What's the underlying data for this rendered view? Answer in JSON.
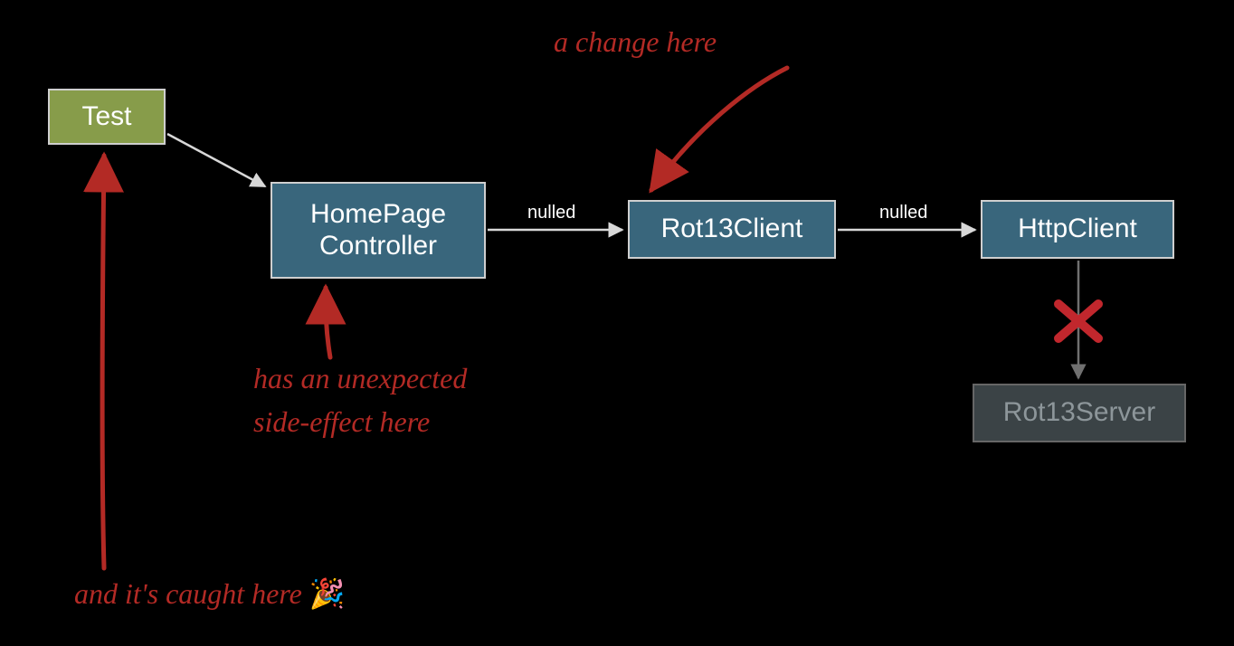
{
  "boxes": {
    "test": {
      "label": "Test"
    },
    "controller": {
      "line1": "HomePage",
      "line2": "Controller"
    },
    "rot13c": {
      "label": "Rot13Client"
    },
    "httpc": {
      "label": "HttpClient"
    },
    "rot13s": {
      "label": "Rot13Server"
    }
  },
  "edges": {
    "e1": {
      "label": "nulled"
    },
    "e2": {
      "label": "nulled"
    }
  },
  "annotations": {
    "a1": "a change here",
    "a2_l1": "has an unexpected",
    "a2_l2": "side-effect here",
    "a3": "and it's caught here",
    "party": "🎉"
  },
  "colors": {
    "olive": "#879c4a",
    "steel": "#39667c",
    "grey": "#3b4346",
    "annot": "#b32a25",
    "cross": "#c1272d"
  }
}
